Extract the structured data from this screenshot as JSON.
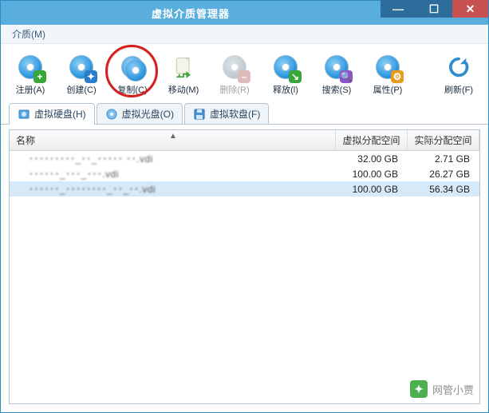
{
  "window": {
    "title": "虚拟介质管理器"
  },
  "menu": {
    "media": "介质(M)"
  },
  "toolbar": {
    "register": {
      "label": "注册(A)"
    },
    "create": {
      "label": "创建(C)"
    },
    "copy": {
      "label": "复制(C)"
    },
    "move": {
      "label": "移动(M)"
    },
    "remove": {
      "label": "删除(R)"
    },
    "release": {
      "label": "释放(l)"
    },
    "search": {
      "label": "搜索(S)"
    },
    "props": {
      "label": "属性(P)"
    },
    "refresh": {
      "label": "刷新(F)"
    }
  },
  "tabs": {
    "hard": {
      "label": "虚拟硬盘(H)"
    },
    "optical": {
      "label": "虚拟光盘(O)"
    },
    "floppy": {
      "label": "虚拟软盘(F)"
    }
  },
  "columns": {
    "name": "名称",
    "virt": "虚拟分配空间",
    "real": "实际分配空间"
  },
  "rows": [
    {
      "name": "･････････_･･_･････ ･･.vdi",
      "virt": "32.00 GB",
      "real": "2.71 GB"
    },
    {
      "name": "･･････_･･･_･･･.vdi",
      "virt": "100.00 GB",
      "real": "26.27 GB"
    },
    {
      "name": "･･････_････････_･･_･･.vdi",
      "virt": "100.00 GB",
      "real": "56.34 GB"
    }
  ],
  "watermark": {
    "text": "网管小贾"
  }
}
